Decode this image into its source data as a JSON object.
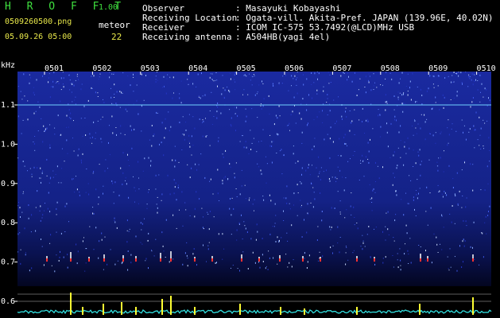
{
  "header": {
    "app_title": "H R O F F T",
    "version": "1.00",
    "file_name": "0509260500.png",
    "datetime": "05.09.26 05:00",
    "meteor_label": "meteor",
    "meteor_count": "22"
  },
  "info": [
    {
      "key": "Observer",
      "value": ": Masayuki Kobayashi"
    },
    {
      "key": "Receiving Location",
      "value": ": Ogata-vill. Akita-Pref. JAPAN (139.96E, 40.02N)"
    },
    {
      "key": "Receiver",
      "value": ": ICOM IC-575 53.7492(@LCD)MHz USB"
    },
    {
      "key": "Receiving antenna",
      "value": ": A504HB(yagi 4el)"
    }
  ],
  "chart_data": {
    "type": "heatmap",
    "ylabel": "kHz",
    "y_ticks": [
      "1.1",
      "1.0",
      "0.9",
      "0.8",
      "0.7",
      "0.6"
    ],
    "x_ticks": [
      "0501",
      "0502",
      "0503",
      "0504",
      "0505",
      "0506",
      "0507",
      "0508",
      "0509",
      "0510"
    ],
    "colors": {
      "background": "#000000",
      "noise": "#1c2a9a",
      "signal": "#ff3030",
      "power": "#ffff33",
      "baseline": "#33e0e0"
    }
  }
}
